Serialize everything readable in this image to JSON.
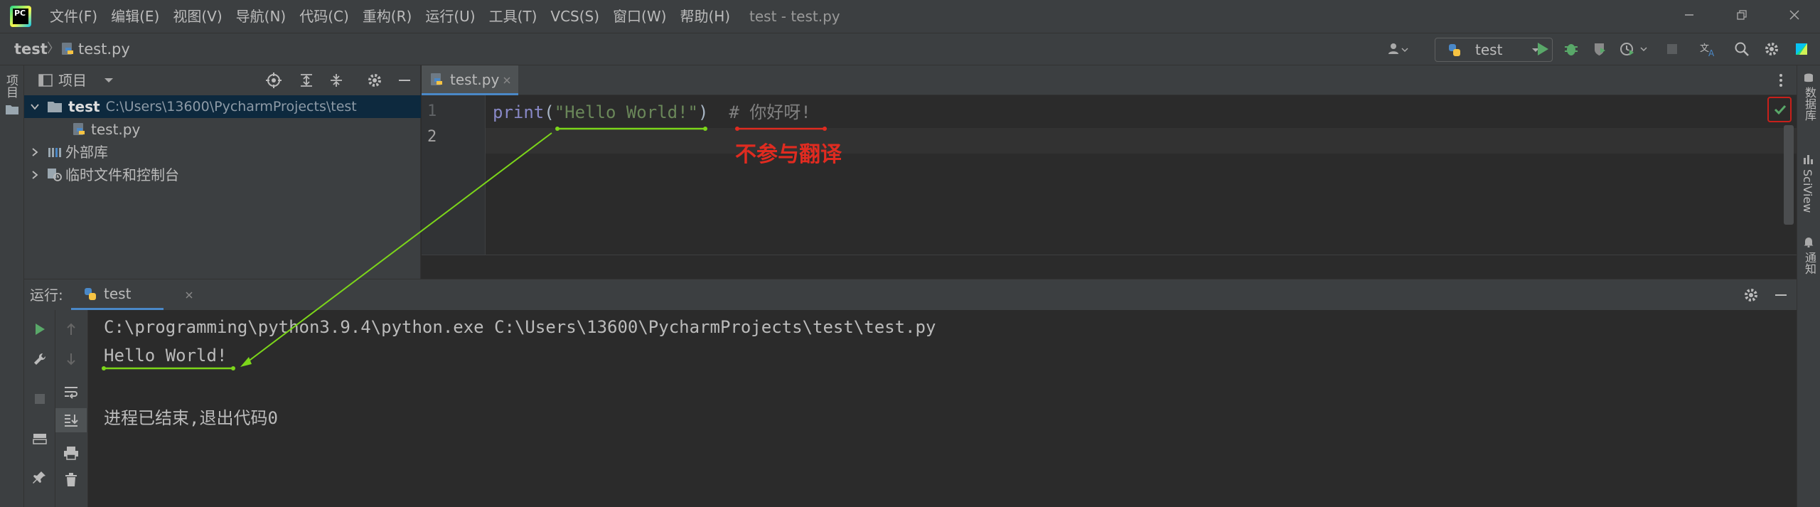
{
  "menu": {
    "items": [
      "文件(F)",
      "编辑(E)",
      "视图(V)",
      "导航(N)",
      "代码(C)",
      "重构(R)",
      "运行(U)",
      "工具(T)",
      "VCS(S)",
      "窗口(W)",
      "帮助(H)"
    ],
    "logo_text": "PC"
  },
  "window_title": "test - test.py",
  "breadcrumb": {
    "project": "test",
    "file": "test.py"
  },
  "run_config": {
    "label": "test"
  },
  "left_strip": {
    "label": "项目"
  },
  "project_panel": {
    "title": "项目",
    "tree": {
      "root_name": "test",
      "root_path": "C:\\Users\\13600\\PycharmProjects\\test",
      "file": "test.py",
      "external_libs": "外部库",
      "scratches": "临时文件和控制台"
    }
  },
  "editor": {
    "tab_label": "test.py",
    "line_numbers": [
      "1",
      "2"
    ],
    "code": {
      "fn": "print",
      "open": "(",
      "str": "\"Hello World!\"",
      "close": ")",
      "comment": "# 你好呀!"
    }
  },
  "annotation": {
    "text": "不参与翻译",
    "color": "#e02b20",
    "arrow_color": "#7cd61a"
  },
  "right_strip": {
    "labels": [
      "数据库",
      "SciView",
      "通知"
    ]
  },
  "run_panel": {
    "label": "运行:",
    "tab_label": "test",
    "console": [
      "C:\\programming\\python3.9.4\\python.exe C:\\Users\\13600\\PycharmProjects\\test\\test.py",
      "Hello World!",
      "",
      "进程已结束,退出代码0"
    ]
  },
  "colors": {
    "accent": "#4a88c7",
    "run_green": "#59a869",
    "check_green": "#59a869"
  }
}
